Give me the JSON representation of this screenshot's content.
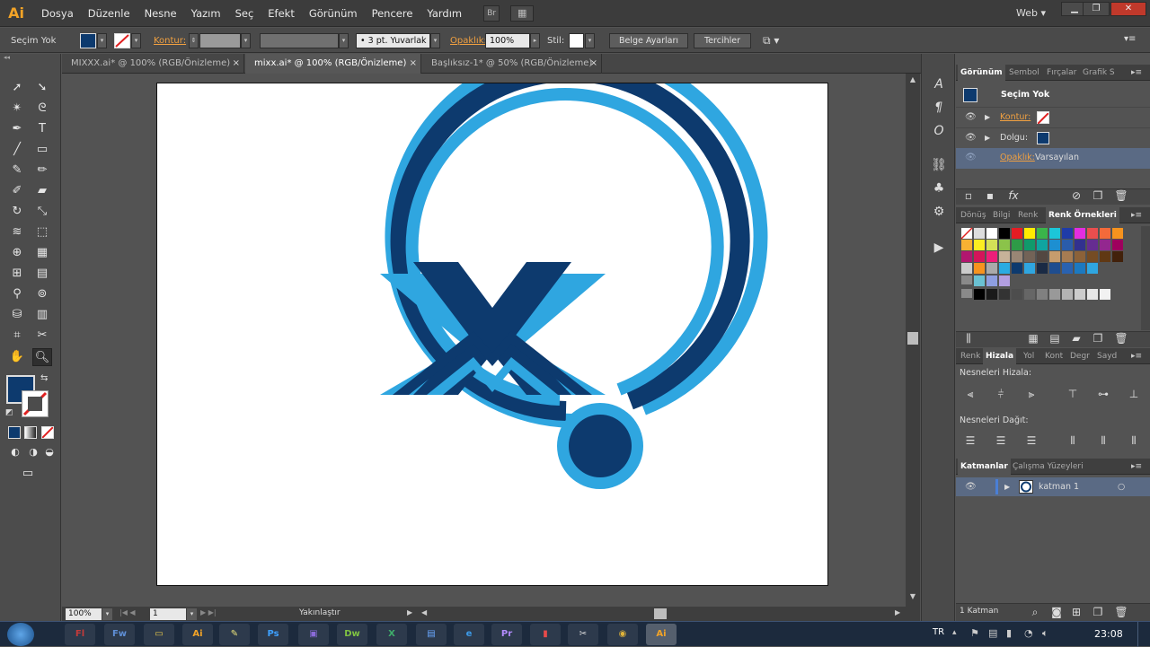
{
  "app": {
    "logo": "Ai",
    "workspace": "Web"
  },
  "menu": [
    "Dosya",
    "Düzenle",
    "Nesne",
    "Yazım",
    "Seç",
    "Efekt",
    "Görünüm",
    "Pencere",
    "Yardım"
  ],
  "menu_buttons": {
    "bridge": "Br",
    "arrange": "▦"
  },
  "control": {
    "selection_label": "Seçim Yok",
    "stroke_label": "Kontur:",
    "brush_value": "3 pt. Yuvarlak",
    "opacity_label": "Opaklık:",
    "opacity_value": "100%",
    "style_label": "Stil:",
    "doc_setup": "Belge Ayarları",
    "prefs": "Tercihler"
  },
  "tabs": [
    {
      "label": "MIXXX.ai* @ 100% (RGB/Önizleme)",
      "active": false
    },
    {
      "label": "mixx.ai* @ 100% (RGB/Önizleme)",
      "active": true
    },
    {
      "label": "Başlıksız-1* @ 50% (RGB/Önizleme)",
      "active": false
    }
  ],
  "status": {
    "zoom": "100%",
    "page": "1",
    "tool_hint": "Yakınlaştır"
  },
  "appearance_panel": {
    "tabs": [
      "Görünüm",
      "Sembol",
      "Fırçalar",
      "Grafik S"
    ],
    "title": "Seçim Yok",
    "rows": [
      {
        "label": "Kontur:",
        "orange": true
      },
      {
        "label": "Dolgu:",
        "orange": false
      }
    ],
    "opacity_label": "Opaklık:",
    "opacity_value": "Varsayılan"
  },
  "swatches_panel": {
    "tabs": [
      "Dönüş",
      "Bilgi",
      "Renk",
      "Renk Örnekleri"
    ]
  },
  "align_panel": {
    "tabs": [
      "Renk",
      "Hizala",
      "Yol",
      "Kont",
      "Degr",
      "Sayd"
    ],
    "align_label": "Nesneleri Hizala:",
    "distribute_label": "Nesneleri Dağıt:"
  },
  "layers_panel": {
    "tabs": [
      "Katmanlar",
      "Çalışma Yüzeyleri"
    ],
    "layer_name": "katman 1",
    "footer": "1 Katman"
  },
  "taskbar": {
    "lang": "TR",
    "time": "23:08",
    "apps": [
      {
        "label": "Fl",
        "color": "#c43a3a"
      },
      {
        "label": "Fw",
        "color": "#5f8fd6"
      },
      {
        "label": "▭",
        "color": "#e6c84a"
      },
      {
        "label": "Ai",
        "color": "#f2a327"
      },
      {
        "label": "✎",
        "color": "#e8e07a"
      },
      {
        "label": "Ps",
        "color": "#3ea0ff"
      },
      {
        "label": "▣",
        "color": "#8a6bd8"
      },
      {
        "label": "Dw",
        "color": "#7fc242"
      },
      {
        "label": "X",
        "color": "#3fae6b"
      },
      {
        "label": "▤",
        "color": "#6aa8ff"
      },
      {
        "label": "e",
        "color": "#3d9be9"
      },
      {
        "label": "Pr",
        "color": "#b38cff"
      },
      {
        "label": "▮",
        "color": "#e84a4a"
      },
      {
        "label": "✂",
        "color": "#e0e0e0"
      },
      {
        "label": "◉",
        "color": "#dfb33a"
      },
      {
        "label": "Ai",
        "color": "#f2a327"
      }
    ]
  },
  "colors": {
    "logo_dark": "#0d3a6e",
    "logo_light": "#2fa6e0",
    "accent_orange": "#f0a041"
  }
}
